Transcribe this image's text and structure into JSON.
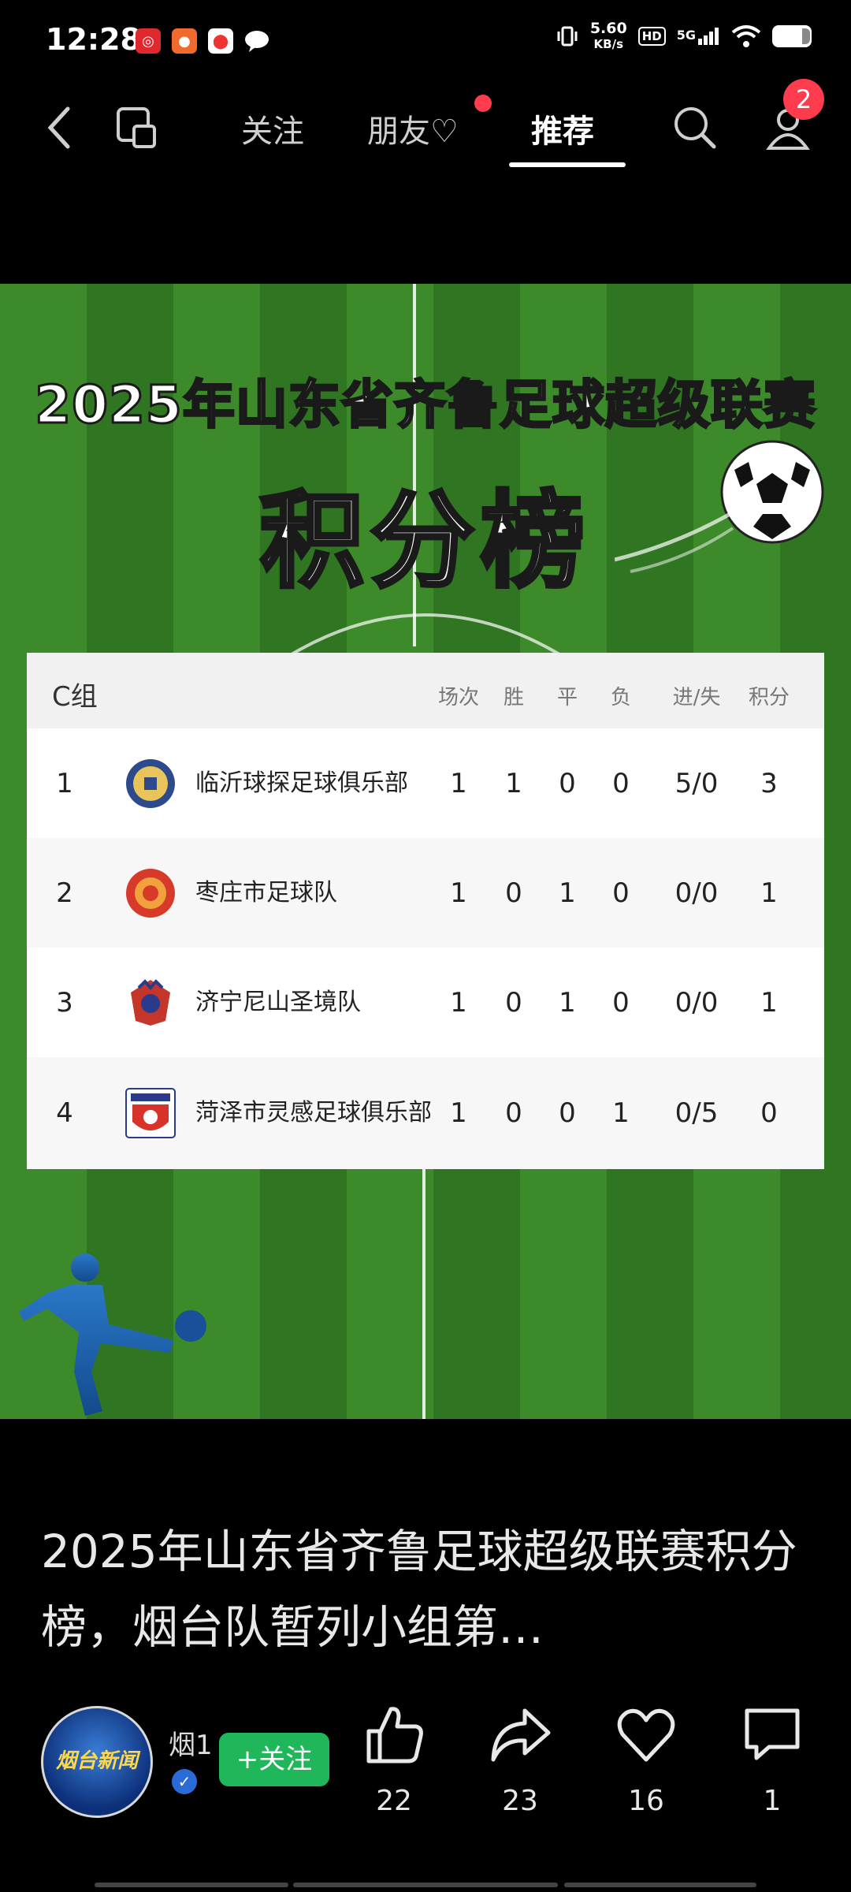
{
  "status_bar": {
    "time": "12:28",
    "net_speed_value": "5.60",
    "net_speed_unit": "KB/s",
    "hd": "HD",
    "signal": "5G"
  },
  "nav": {
    "tabs": [
      {
        "label": "关注"
      },
      {
        "label": "朋友♡"
      },
      {
        "label": "推荐"
      }
    ],
    "active_tab": "推荐",
    "profile_badge": "2"
  },
  "post_image": {
    "title": "2025年山东省齐鲁足球超级联赛",
    "subtitle": "积分榜",
    "table": {
      "group": "C组",
      "columns": [
        "场次",
        "胜",
        "平",
        "负",
        "进/失",
        "积分"
      ],
      "rows": [
        {
          "rank": "1",
          "team": "临沂球探足球俱乐部",
          "played": "1",
          "won": "1",
          "drawn": "0",
          "lost": "0",
          "goals": "5/0",
          "points": "3"
        },
        {
          "rank": "2",
          "team": "枣庄市足球队",
          "played": "1",
          "won": "0",
          "drawn": "1",
          "lost": "0",
          "goals": "0/0",
          "points": "1"
        },
        {
          "rank": "3",
          "team": "济宁尼山圣境队",
          "played": "1",
          "won": "0",
          "drawn": "1",
          "lost": "0",
          "goals": "0/0",
          "points": "1"
        },
        {
          "rank": "4",
          "team": "菏泽市灵感足球俱乐部",
          "played": "1",
          "won": "0",
          "drawn": "0",
          "lost": "1",
          "goals": "0/5",
          "points": "0"
        }
      ]
    }
  },
  "caption": "2025年山东省齐鲁足球超级联赛积分榜，烟台队暂列小组第…",
  "author": {
    "name": "烟1",
    "avatar_text": "烟台新闻",
    "follow_label": "+关注"
  },
  "actions": {
    "like_count": "22",
    "share_count": "23",
    "favorite_count": "16",
    "comment_count": "1"
  },
  "colors": {
    "follow_green": "#1fb75a",
    "badge_red": "#ff3b4e",
    "field_green_light": "#3d8a2b",
    "field_green_dark": "#2f7522"
  },
  "icons": [
    "back-icon",
    "screen-cast-icon",
    "search-icon",
    "profile-icon",
    "thumbs-up-icon",
    "share-icon",
    "heart-icon",
    "comment-icon",
    "soccer-ball-icon"
  ]
}
